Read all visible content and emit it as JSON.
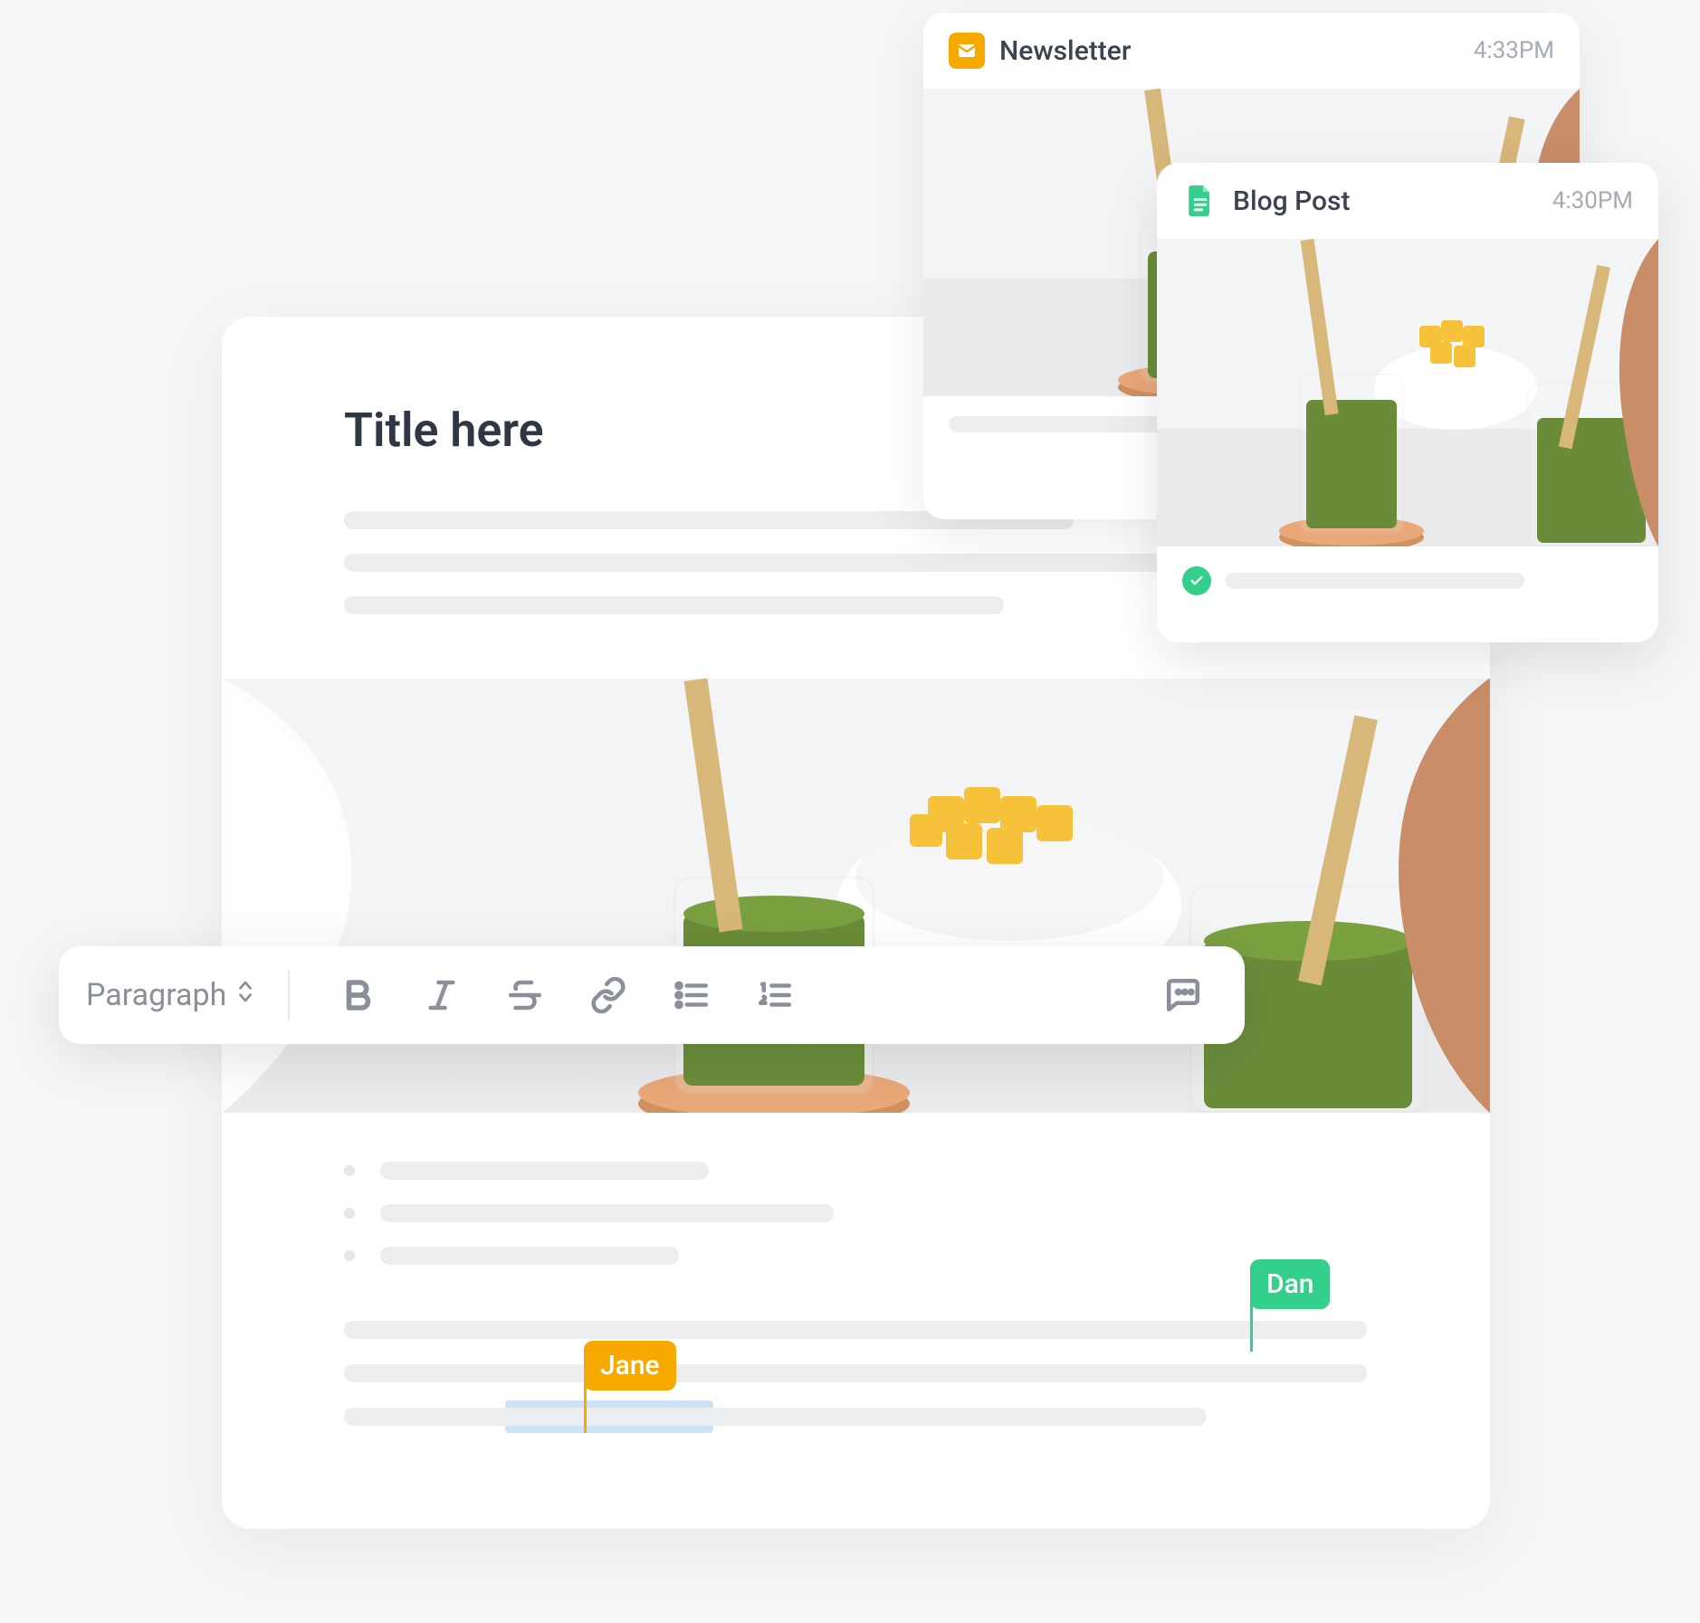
{
  "editor": {
    "title": "Title here"
  },
  "toolbar": {
    "format_selector": "Paragraph"
  },
  "cursors": {
    "dan": "Dan",
    "jane": "Jane"
  },
  "cards": {
    "newsletter": {
      "title": "Newsletter",
      "time": "4:33PM"
    },
    "blogpost": {
      "title": "Blog Post",
      "time": "4:30PM"
    }
  },
  "colors": {
    "accent_green": "#34cf8a",
    "accent_amber": "#f6a900"
  }
}
